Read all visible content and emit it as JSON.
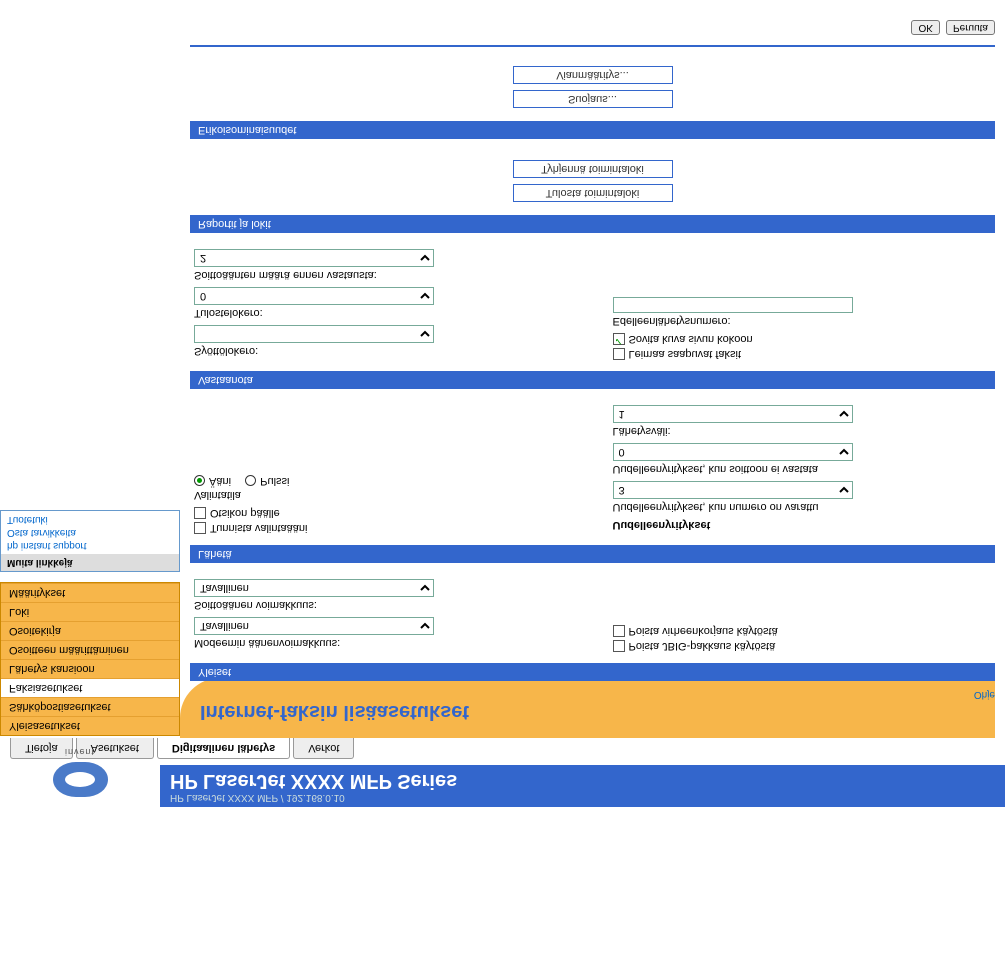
{
  "header": {
    "sub": "HP LaserJet XXXX MFP / 192.168.0.10",
    "title": "HP LaserJet XXXX MFP Series",
    "invent": "invent"
  },
  "tabs": [
    "Tietoja",
    "Asetukset",
    "Digitaalinen lähetys",
    "Verkot"
  ],
  "nav": [
    "Yleisasetukset",
    "Sähköpostiasetukset",
    "Faksiasetukset",
    "Lähetys kansioon",
    "Osoitteen määrittäminen",
    "Osoitekirja",
    "Loki",
    "Määritykset"
  ],
  "links": {
    "head": "Muita linkkejä",
    "items": [
      "hp instant support",
      "Osta tarvikkeita",
      "Tuotetuki"
    ]
  },
  "page": {
    "title": "Internet-faksin lisäasetukset",
    "help": "Ohje"
  },
  "sec_general": {
    "title": "Yleiset",
    "modem_vol": "Modeemin äänenvoimakkuus:",
    "modem_vol_val": "Tavallinen",
    "ring_vol": "Soittoäänen voimakkuus:",
    "ring_vol_val": "Tavallinen",
    "jbig": "Poista JBIG-pakkaus käytöstä",
    "err": "Poista virheenkorjaus käytöstä"
  },
  "sec_send": {
    "title": "Lähetä",
    "detect_tone": "Tunnista valintaääni",
    "header_on": "Otsikon päälle",
    "dial_mode": "Valintatila",
    "tone": "Ääni",
    "pulse": "Pulssi",
    "retries": "Uudelleenyritykset",
    "retry_busy": "Uudelleenyritykset, kun numero on varattu",
    "retry_busy_val": "3",
    "retry_noans": "Uudelleenyritykset, kun soittoon ei vastata",
    "retry_noans_val": "0",
    "interval": "Lähetysväli:",
    "interval_val": "1"
  },
  "sec_recv": {
    "title": "Vastaanota",
    "in_tray": "Syöttölokero:",
    "out_tray": "Tulostelokero:",
    "out_tray_val": "0",
    "rings": "Soittoäänten määrä ennen vastausta:",
    "rings_val": "2",
    "stamp": "Leimaa saapuvat faksit",
    "fit": "Sovita kuva sivun kokoon",
    "fwd": "Edelleenlähetysnumero:"
  },
  "sec_reports": {
    "title": "Raportit ja lokit",
    "print_log": "Tulosta toimintaloki",
    "clear_log": "Tyhjennä toimintaloki"
  },
  "sec_special": {
    "title": "Erikoisominaisuudet",
    "security": "Suojaus...",
    "diag": "Vianmääritys..."
  },
  "footer": {
    "ok": "OK",
    "cancel": "Peruuta"
  }
}
